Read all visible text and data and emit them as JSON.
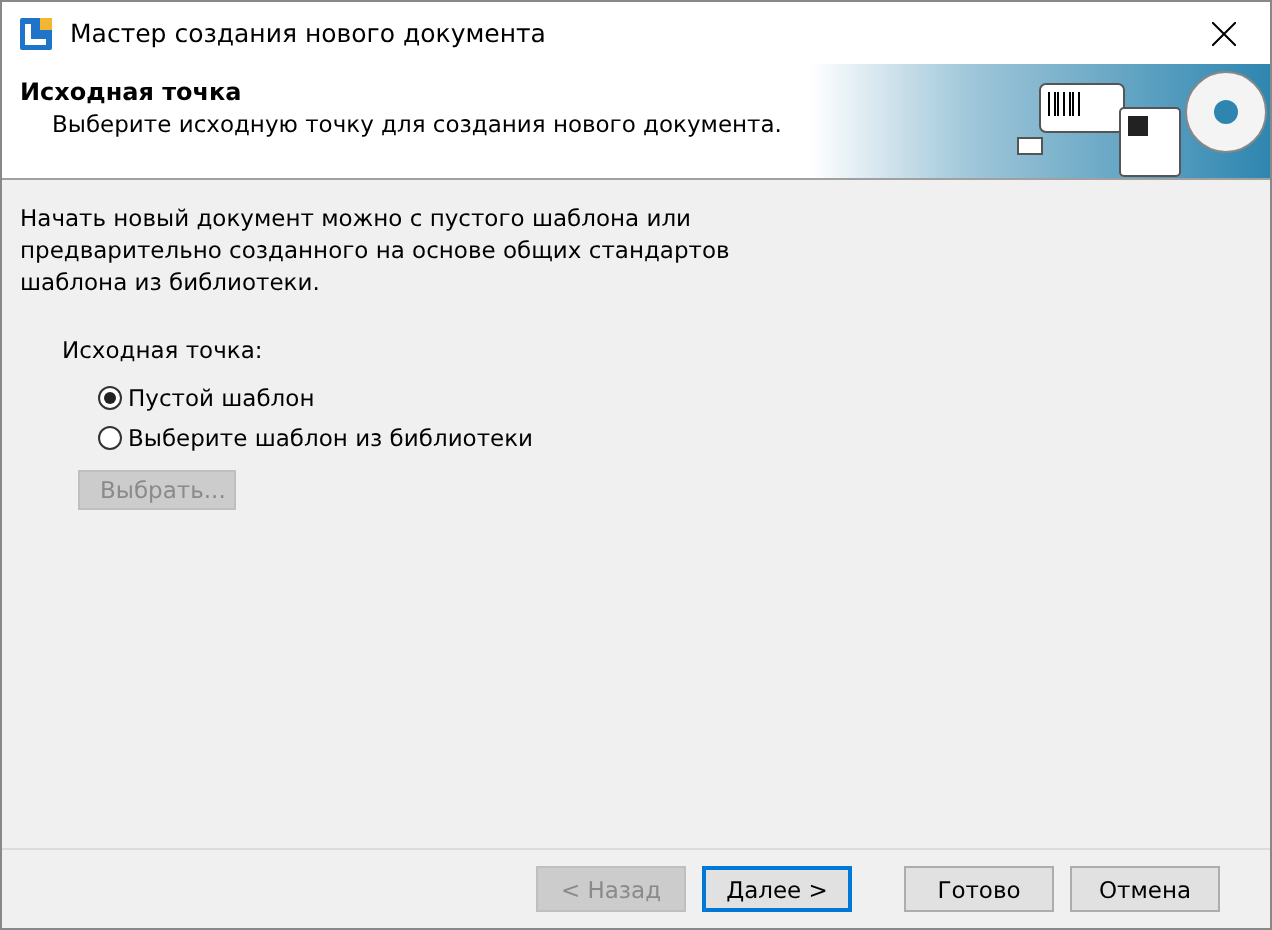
{
  "window": {
    "title": "Мастер создания нового документа"
  },
  "header": {
    "title": "Исходная точка",
    "subtitle": "Выберите исходную точку для создания нового документа."
  },
  "description": "Начать новый документ можно с пустого шаблона или предварительно созданного на основе общих стандартов шаблона из библиотеки.",
  "source": {
    "label": "Исходная точка:",
    "options": [
      {
        "label": "Пустой шаблон",
        "selected": true
      },
      {
        "label": "Выберите шаблон из библиотеки",
        "selected": false
      }
    ],
    "browse_button": {
      "label": "Выбрать...",
      "disabled": true
    }
  },
  "buttons": [
    {
      "label": "< Назад",
      "disabled": true,
      "default": false
    },
    {
      "label": "Далее >",
      "disabled": false,
      "default": true
    },
    {
      "label": "Готово",
      "disabled": false,
      "default": false
    },
    {
      "label": "Отмена",
      "disabled": false,
      "default": false
    }
  ]
}
